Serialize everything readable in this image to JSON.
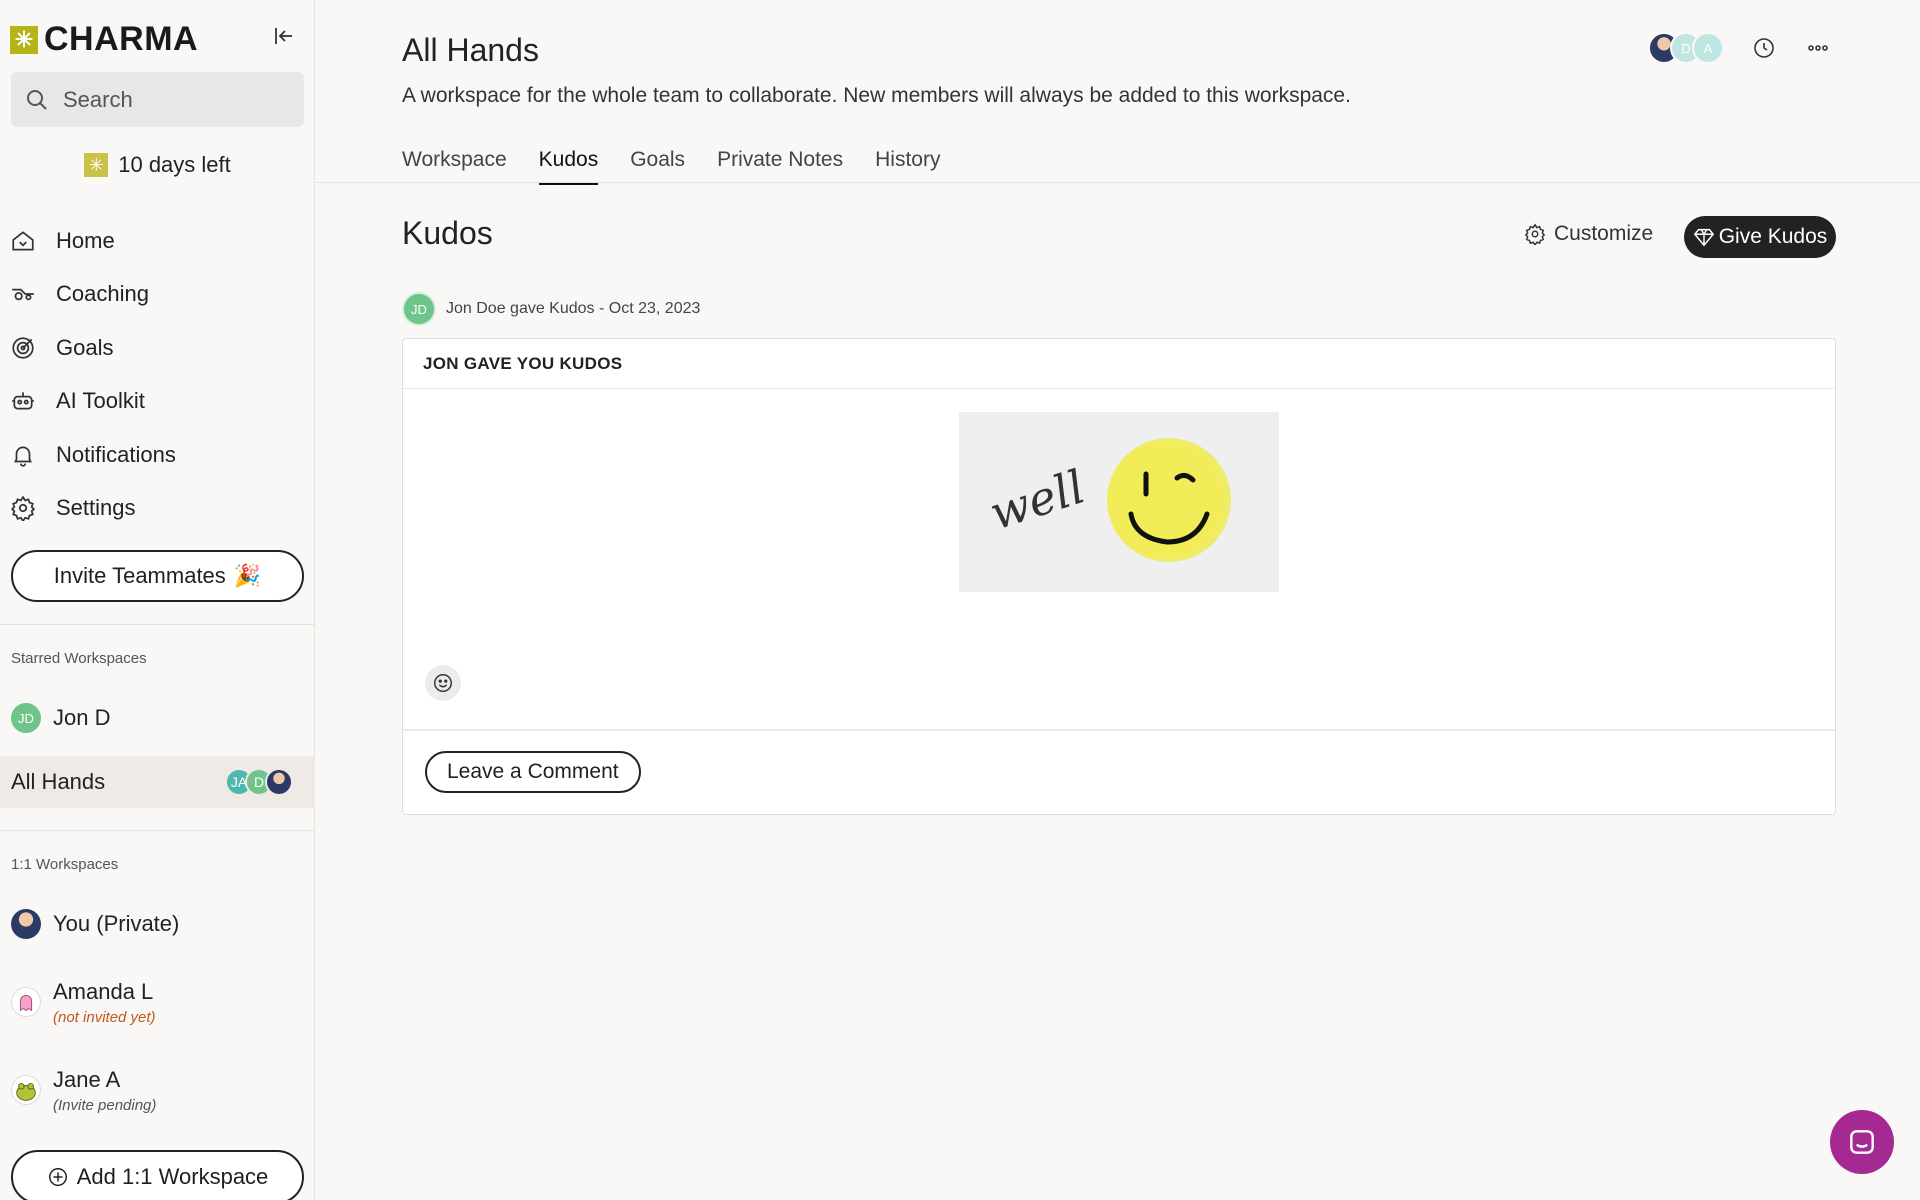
{
  "app": {
    "logo_text": "CHARMA",
    "logo_icon": "sparkle-icon"
  },
  "search": {
    "placeholder": "Search"
  },
  "trial": {
    "text": "10 days left"
  },
  "nav": [
    {
      "label": "Home",
      "icon": "home-icon"
    },
    {
      "label": "Coaching",
      "icon": "coaching-icon"
    },
    {
      "label": "Goals",
      "icon": "target-icon"
    },
    {
      "label": "AI Toolkit",
      "icon": "robot-icon"
    },
    {
      "label": "Notifications",
      "icon": "bell-icon"
    },
    {
      "label": "Settings",
      "icon": "gear-icon"
    }
  ],
  "invite": {
    "label": "Invite Teammates",
    "emoji": "🎉"
  },
  "starred": {
    "label": "Starred Workspaces",
    "items": [
      {
        "name": "Jon D",
        "initials": "JD"
      },
      {
        "name": "All Hands",
        "avatars": [
          "JA",
          "D",
          ""
        ]
      }
    ]
  },
  "oneonone": {
    "label": "1:1 Workspaces",
    "items": [
      {
        "name": "You (Private)"
      },
      {
        "name": "Amanda L",
        "status": "(not invited yet)"
      },
      {
        "name": "Jane A",
        "status": "(Invite pending)"
      }
    ],
    "add_label": "Add 1:1 Workspace"
  },
  "header": {
    "title": "All Hands",
    "description": "A workspace for the whole team to collaborate. New members will always be added to this workspace.",
    "avatars": [
      "",
      "D",
      "A"
    ]
  },
  "tabs": [
    "Workspace",
    "Kudos",
    "Goals",
    "Private Notes",
    "History"
  ],
  "active_tab": "Kudos",
  "kudos": {
    "title": "Kudos",
    "customize_label": "Customize",
    "give_label": "Give Kudos",
    "post": {
      "author_initials": "JD",
      "meta": "Jon Doe gave Kudos - Oct 23, 2023",
      "heading": "JON GAVE YOU KUDOS",
      "image_text": "well",
      "comment_label": "Leave a Comment"
    }
  },
  "colors": {
    "accent": "#b7b41a",
    "dark_button": "#222222",
    "chat_launcher": "#a42a92",
    "status_orange": "#c2571a",
    "avatar_green": "#6fc48a"
  }
}
